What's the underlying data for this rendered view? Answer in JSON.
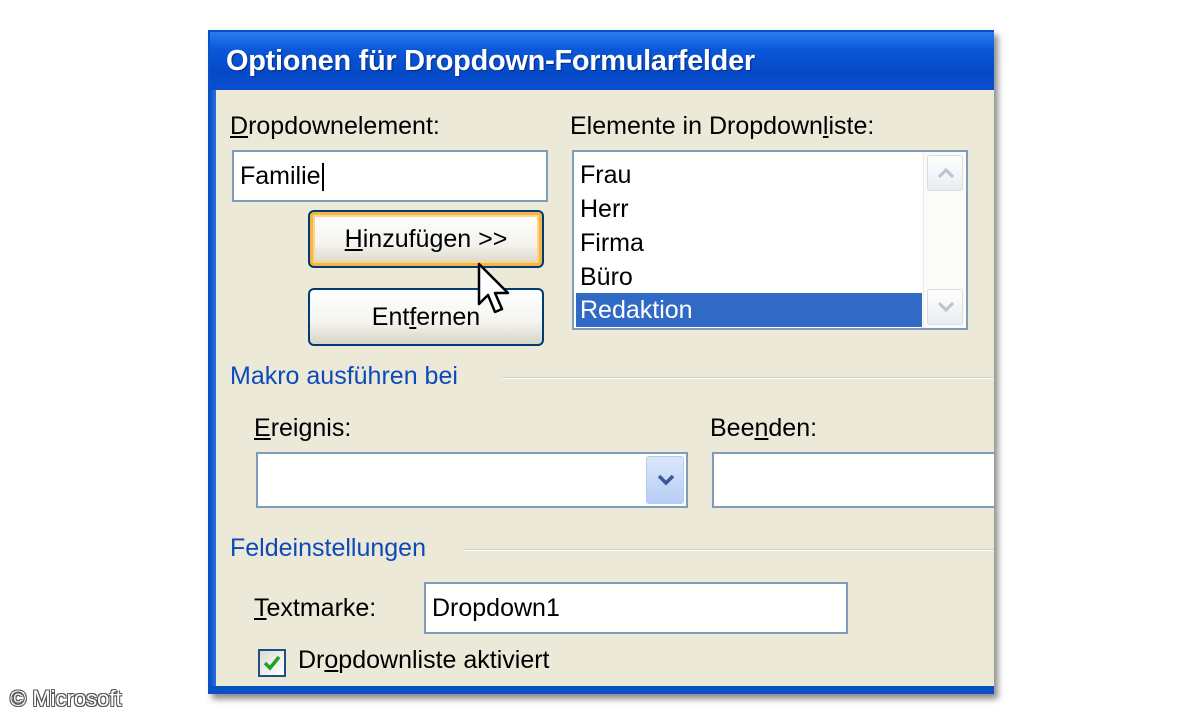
{
  "dialog": {
    "title": "Optionen für Dropdown-Formularfelder"
  },
  "dropdown_element": {
    "label_pre": "",
    "label_key": "D",
    "label_post": "ropdownelement:",
    "value": "Familie"
  },
  "buttons": {
    "add_key": "H",
    "add_post": "inzufügen >>",
    "remove_pre": "Ent",
    "remove_key": "f",
    "remove_post": "ernen"
  },
  "list": {
    "label_pre": "Elemente in Dropdown",
    "label_key": "l",
    "label_post": "iste:",
    "items": [
      "Frau",
      "Herr",
      "Firma",
      "Büro",
      "Redaktion"
    ],
    "selected": "Redaktion"
  },
  "macro": {
    "group_title": "Makro ausführen bei",
    "event_key": "E",
    "event_post": "reignis:",
    "event_value": "",
    "exit_pre": "Bee",
    "exit_key": "n",
    "exit_post": "den:",
    "exit_value": ""
  },
  "field_settings": {
    "group_title": "Feldeinstellungen",
    "bookmark_key": "T",
    "bookmark_post": "extmarke:",
    "bookmark_value": "Dropdown1",
    "enabled_pre": "Dr",
    "enabled_key": "o",
    "enabled_post": "pdownliste aktiviert",
    "enabled_checked": true
  },
  "copyright": "© Microsoft",
  "icons": {
    "scroll_up": "chevron-up-icon",
    "scroll_down": "chevron-down-icon",
    "combo_arrow": "chevron-down-icon",
    "check": "checkmark-icon",
    "cursor": "mouse-pointer-icon"
  },
  "colors": {
    "titlebar": "#0a58d9",
    "selection": "#316ac5",
    "group_title": "#0b4ab8",
    "dialog_bg": "#ece9d8"
  }
}
